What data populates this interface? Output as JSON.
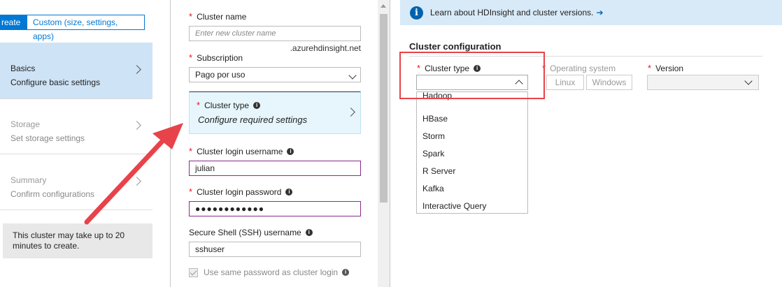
{
  "tabs": {
    "quick_create": "reate",
    "custom": "Custom (size, settings, apps)"
  },
  "steps": [
    {
      "title": "Basics",
      "subtitle": "Configure basic settings"
    },
    {
      "title": "Storage",
      "subtitle": "Set storage settings"
    },
    {
      "title": "Summary",
      "subtitle": "Confirm configurations"
    }
  ],
  "note": "This cluster may take up to 20 minutes to create.",
  "form": {
    "cluster_name_label": "Cluster name",
    "cluster_name_placeholder": "Enter new cluster name",
    "cluster_name_suffix": ".azurehdinsight.net",
    "subscription_label": "Subscription",
    "subscription_value": "Pago por uso",
    "cluster_type_label": "Cluster type",
    "cluster_type_value": "Configure required settings",
    "login_username_label": "Cluster login username",
    "login_username_value": "julian",
    "login_password_label": "Cluster login password",
    "login_password_value": "●●●●●●●●●●●●",
    "ssh_username_label": "Secure Shell (SSH) username",
    "ssh_username_value": "sshuser",
    "same_password_label": "Use same password as cluster login",
    "info_glyph": "i",
    "required_glyph": "*"
  },
  "right": {
    "info_text": "Learn about HDInsight and cluster versions.",
    "info_arrow": "➔",
    "info_glyph": "i",
    "section_title": "Cluster configuration",
    "cluster_type_label": "Cluster type",
    "os_label": "Operating system",
    "os_options": [
      "Linux",
      "Windows"
    ],
    "version_label": "Version",
    "cluster_type_options": [
      "Hadoop",
      "HBase",
      "Storm",
      "Spark",
      "R Server",
      "Kafka",
      "Interactive Query"
    ]
  },
  "colors": {
    "accent": "#0078d4",
    "selected_step": "#cfe3f6",
    "required": "#e81123",
    "annotation": "#e8434a"
  }
}
